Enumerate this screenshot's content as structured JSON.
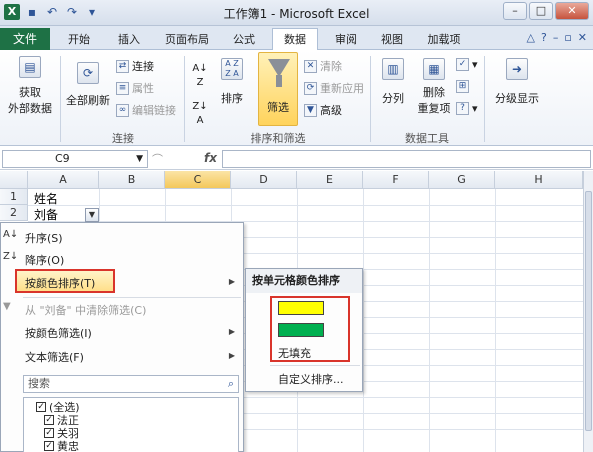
{
  "window": {
    "title": "工作簿1 - Microsoft Excel",
    "qat": {
      "app_icon": "X"
    }
  },
  "tabs": [
    {
      "label": "文件"
    },
    {
      "label": "开始"
    },
    {
      "label": "插入"
    },
    {
      "label": "页面布局"
    },
    {
      "label": "公式"
    },
    {
      "label": "数据",
      "active": true
    },
    {
      "label": "审阅"
    },
    {
      "label": "视图"
    },
    {
      "label": "加载项"
    }
  ],
  "ribbon": {
    "get_external": "获取\n外部数据",
    "refresh_all": "全部刷新",
    "connections": "连接",
    "properties": "属性",
    "edit_links": "编辑链接",
    "group_connections": "连接",
    "sort_az": "A↓Z",
    "sort": "排序",
    "filter": "筛选",
    "clear": "清除",
    "reapply": "重新应用",
    "advanced": "高级",
    "group_sort_filter": "排序和筛选",
    "text_to_columns": "分列",
    "remove_duplicates": "删除\n重复项",
    "group_data_tools": "数据工具",
    "outline": "分级显示"
  },
  "formula_bar": {
    "name_box": "C9",
    "fx": "fx",
    "formula": ""
  },
  "grid": {
    "columns": [
      "A",
      "B",
      "C",
      "D",
      "E",
      "F",
      "G",
      "H"
    ],
    "selected_column": "C",
    "rows": [
      "1",
      "2"
    ],
    "cells": {
      "A1": "姓名",
      "A2": "刘备"
    }
  },
  "filter_menu": {
    "sort_asc": "升序(S)",
    "sort_desc": "降序(O)",
    "sort_by_color": "按颜色排序(T)",
    "clear_filter": "从 \"刘备\" 中清除筛选(C)",
    "filter_by_color": "按颜色筛选(I)",
    "text_filter": "文本筛选(F)",
    "search_placeholder": "搜索",
    "items": [
      {
        "label": "(全选)",
        "checked": true
      },
      {
        "label": "法正",
        "checked": true
      },
      {
        "label": "关羽",
        "checked": true
      },
      {
        "label": "黄忠",
        "checked": true
      }
    ]
  },
  "submenu": {
    "heading": "按单元格颜色排序",
    "colors": [
      "#ffff00",
      "#00b050"
    ],
    "no_fill": "无填充",
    "custom_sort": "自定义排序..."
  }
}
